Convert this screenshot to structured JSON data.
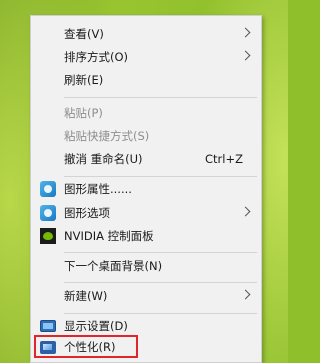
{
  "menu": {
    "view": "查看(V)",
    "sort": "排序方式(O)",
    "refresh": "刷新(E)",
    "paste": "粘贴(P)",
    "paste_shortcut": "粘贴快捷方式(S)",
    "undo_rename": "撤消 重命名(U)",
    "undo_shortcut": "Ctrl+Z",
    "graphics_properties": "图形属性......",
    "graphics_options": "图形选项",
    "nvidia_panel": "NVIDIA 控制面板",
    "next_background": "下一个桌面背景(N)",
    "new": "新建(W)",
    "display_settings": "显示设置(D)",
    "personalize": "个性化(R)"
  },
  "colors": {
    "highlight_border": "#e0262d",
    "menu_bg": "#f1f1f1",
    "disabled_text": "#8e8e8e"
  },
  "icons": {
    "graphics_properties": "intel-graphics-icon",
    "graphics_options": "intel-graphics-icon",
    "nvidia_panel": "nvidia-icon",
    "display_settings": "monitor-icon",
    "personalize": "personalize-icon"
  }
}
